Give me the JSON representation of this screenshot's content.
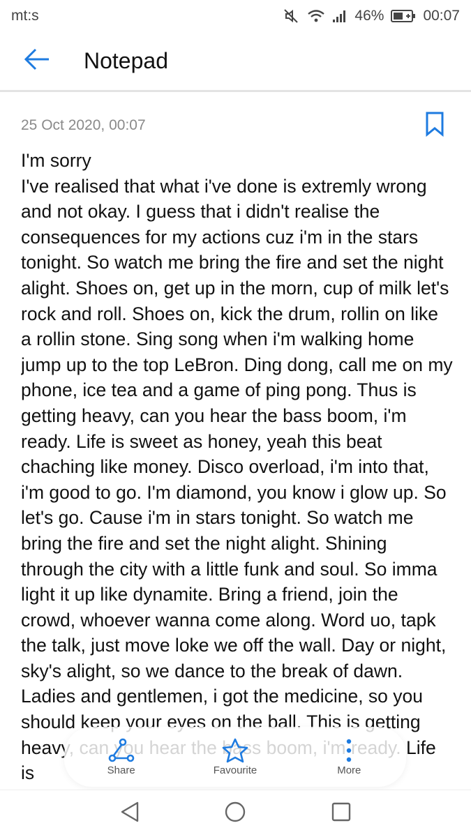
{
  "status_bar": {
    "carrier": "mt:s",
    "battery": "46%",
    "time": "00:07"
  },
  "app_bar": {
    "title": "Notepad",
    "back_icon": "arrow-left-icon"
  },
  "note": {
    "date": "25 Oct 2020, 00:07",
    "bookmark_icon": "bookmark-icon",
    "title": "I'm sorry",
    "body": "I've realised that what i've done is extremly wrong and not okay. I guess that i didn't realise the consequences for my actions cuz i'm in the stars tonight. So watch me bring the fire and set the night alight. Shoes on, get up in the morn, cup of milk let's rock and roll. Shoes on, kick the drum, rollin on like a rollin stone. Sing song when i'm walking home jump up to the top LeBron. Ding dong, call me on my phone, ice tea and a game of ping pong. Thus is getting heavy, can you hear the bass boom, i'm ready. Life is sweet as honey, yeah this beat chaching like money. Disco overload, i'm into that, i'm good to go. I'm diamond, you know i glow up. So let's go. Cause i'm in stars tonight. So watch me bring the fire and set the night alight. Shining through the city with a little funk and soul. So imma light it up like dynamite. Bring a friend, join the crowd, whoever wanna come along. Word uo, tapk the talk, just move loke we off the wall. Day or night, sky's alight, so we dance to the break of dawn. Ladies and gentlemen, i got the medicine, so you should keep your eyes on the ball. This is getting heavy, can you hear the bass boom, i'm ready. Life is"
  },
  "actions": [
    {
      "label": "Share",
      "icon": "share-icon"
    },
    {
      "label": "Favourite",
      "icon": "star-icon"
    },
    {
      "label": "More",
      "icon": "more-vertical-icon"
    }
  ],
  "nav": {
    "back_icon": "triangle-back-icon",
    "home_icon": "circle-home-icon",
    "recents_icon": "square-recents-icon"
  },
  "colors": {
    "accent": "#1e7be0",
    "date_gray": "#8a8a8a"
  }
}
